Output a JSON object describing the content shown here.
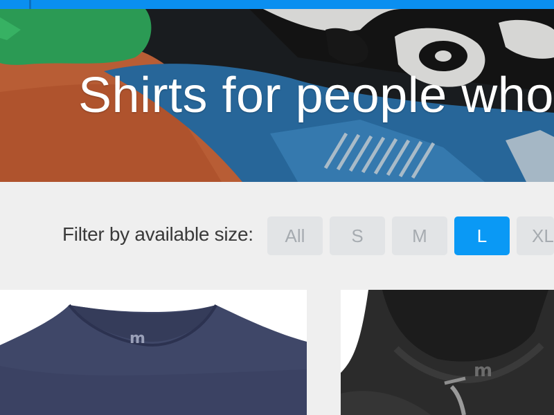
{
  "hero": {
    "title": "Shirts for people who"
  },
  "filter": {
    "label": "Filter by available size:",
    "sizes": [
      "All",
      "S",
      "M",
      "L",
      "XL"
    ],
    "selected": "L"
  },
  "products": [
    {
      "color": "heather-navy",
      "logo": "m"
    },
    {
      "color": "charcoal",
      "logo": "m"
    }
  ],
  "colors": {
    "accent": "#0a99f5",
    "top_bar": "#0a8ff0",
    "inactive_button": "#e2e4e6",
    "inactive_text": "#a6abb0",
    "background": "#efefef"
  },
  "icons": {
    "brand_logo": "m-logo-icon"
  }
}
